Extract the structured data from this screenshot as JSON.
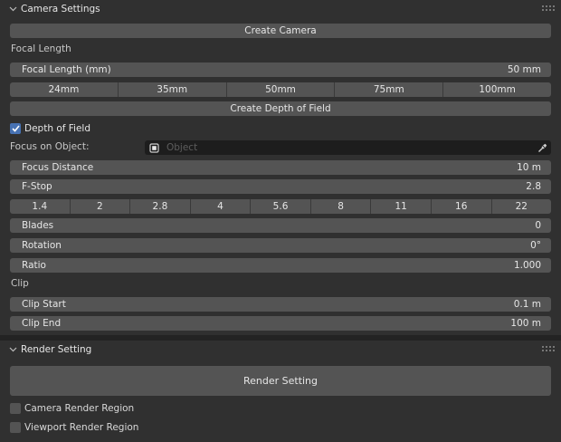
{
  "camera_panel": {
    "title": "Camera Settings",
    "create_camera": "Create Camera",
    "focal_section": "Focal Length",
    "focal_field": {
      "label": "Focal Length (mm)",
      "value": "50 mm"
    },
    "focal_presets": [
      "24mm",
      "35mm",
      "50mm",
      "75mm",
      "100mm"
    ],
    "create_dof": "Create Depth of Field",
    "dof_checkbox": {
      "label": "Depth of Field",
      "checked": true
    },
    "focus_object": {
      "label": "Focus on Object:",
      "placeholder": "Object"
    },
    "focus_distance": {
      "label": "Focus Distance",
      "value": "10 m"
    },
    "fstop": {
      "label": "F-Stop",
      "value": "2.8"
    },
    "fstop_presets": [
      "1.4",
      "2",
      "2.8",
      "4",
      "5.6",
      "8",
      "11",
      "16",
      "22"
    ],
    "blades": {
      "label": "Blades",
      "value": "0"
    },
    "rotation": {
      "label": "Rotation",
      "value": "0°"
    },
    "ratio": {
      "label": "Ratio",
      "value": "1.000"
    },
    "clip_section": "Clip",
    "clip_start": {
      "label": "Clip Start",
      "value": "0.1 m"
    },
    "clip_end": {
      "label": "Clip End",
      "value": "100 m"
    }
  },
  "render_panel": {
    "title": "Render Setting",
    "render_button": "Render Setting",
    "camera_region": {
      "label": "Camera Render Region",
      "checked": false
    },
    "viewport_region": {
      "label": "Viewport Render Region",
      "checked": false
    }
  },
  "colors": {
    "background": "#303030",
    "widget": "#545454",
    "accent": "#4772b3",
    "object_field": "#1d1d1d"
  }
}
